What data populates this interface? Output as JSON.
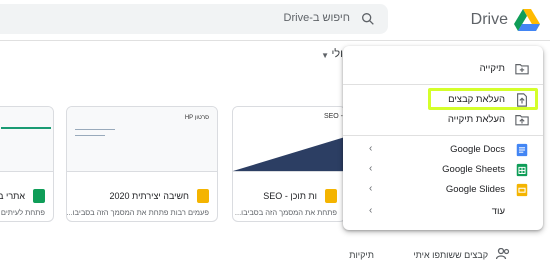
{
  "brand": {
    "name": "Drive"
  },
  "search": {
    "placeholder": "חיפוש ב-Drive"
  },
  "my_drive": {
    "label": "ולי"
  },
  "cards": [
    {
      "title": "אתרי בית",
      "subtitle": "פתחת לעיתים קרובות"
    },
    {
      "thumb_title": "סרטון HP",
      "title": "חשיבה יצירתית 2020",
      "subtitle": "פעמים רבות פתחת את המסמך הזה בסביבו..."
    },
    {
      "thumb_title": "SEO -",
      "title": "ות תוכן - SEO",
      "subtitle": "פתחת את המסמך הזה בסביבו..."
    }
  ],
  "bottom": {
    "folders_label": "תיקיות",
    "shared_label": "קבצים ששותפו איתי"
  },
  "menu": {
    "items": [
      {
        "label": "תיקייה",
        "icon": "new-folder-icon"
      },
      {
        "label": "העלאת קבצים",
        "icon": "file-upload-icon"
      },
      {
        "label": "העלאת תיקייה",
        "icon": "folder-upload-icon"
      },
      {
        "label": "Google Docs",
        "icon": "google-docs-icon",
        "color": "#4285f4"
      },
      {
        "label": "Google Sheets",
        "icon": "google-sheets-icon",
        "color": "#0f9d58"
      },
      {
        "label": "Google Slides",
        "icon": "google-slides-icon",
        "color": "#f4b400"
      },
      {
        "label": "עוד",
        "icon": ""
      }
    ]
  },
  "colors": {
    "highlight": "#d4ff2a",
    "docs": "#4285f4",
    "sheets": "#0f9d58",
    "slides": "#f4b400"
  }
}
